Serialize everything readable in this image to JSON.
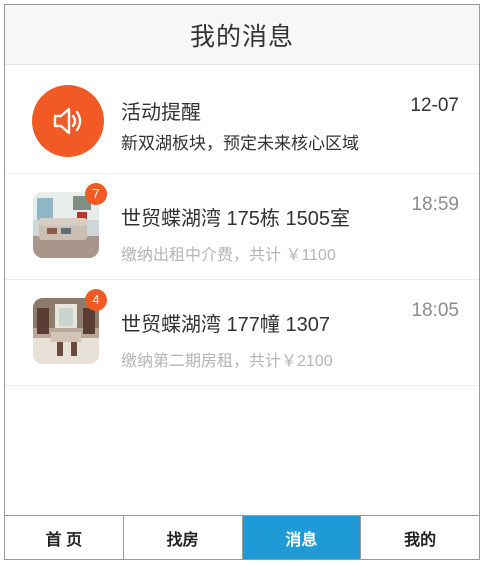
{
  "header": {
    "title": "我的消息"
  },
  "messages": [
    {
      "type": "notice",
      "icon": "speaker-icon",
      "title": "活动提醒",
      "subtitle": "新双湖板块，预定未来核心区域",
      "time": "12-07"
    },
    {
      "type": "photo",
      "icon": "room-photo",
      "badge": "7",
      "title": "世贸蝶湖湾  175栋 1505室",
      "subtitle": "缴纳出租中介费，共计 ￥1100",
      "time": "18:59"
    },
    {
      "type": "photo",
      "icon": "room-photo",
      "badge": "4",
      "title": "世贸蝶湖湾  177幢 1307",
      "subtitle": "缴纳第二期房租，共计￥2100",
      "time": "18:05"
    }
  ],
  "tabs": [
    {
      "label": "首 页",
      "active": false
    },
    {
      "label": "找房",
      "active": false
    },
    {
      "label": "消息",
      "active": true
    },
    {
      "label": "我的",
      "active": false
    }
  ],
  "colors": {
    "accent": "#f15a24",
    "tab_active": "#1e9bd7"
  }
}
